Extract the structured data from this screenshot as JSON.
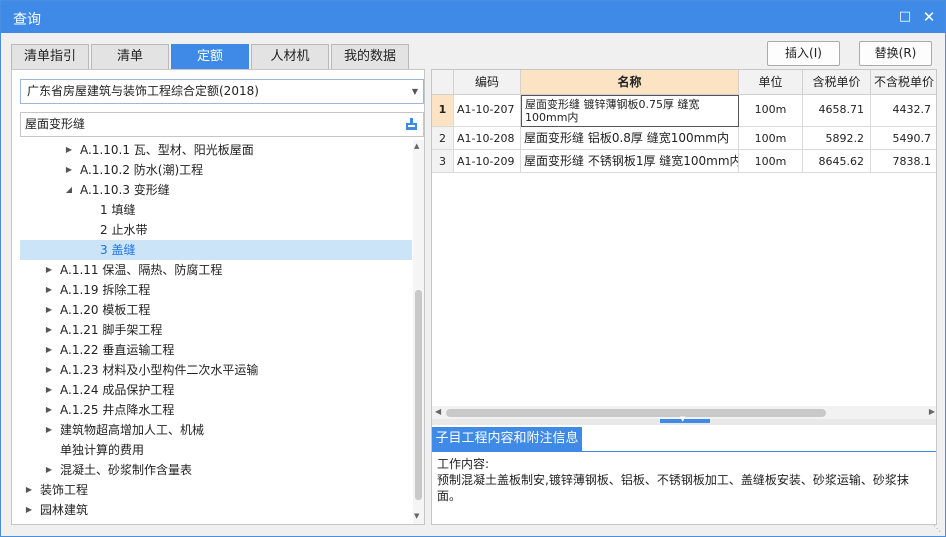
{
  "window": {
    "title": "查询",
    "maximize_icon": "maximize-icon",
    "close_icon": "close-icon"
  },
  "tabs": [
    {
      "label": "清单指引",
      "active": false
    },
    {
      "label": "清单",
      "active": false
    },
    {
      "label": "定额",
      "active": true
    },
    {
      "label": "人材机",
      "active": false
    },
    {
      "label": "我的数据",
      "active": false
    }
  ],
  "actions": {
    "insert": "插入(I)",
    "replace": "替换(R)"
  },
  "library": {
    "selected": "广东省房屋建筑与装饰工程综合定额(2018)"
  },
  "search": {
    "value": "屋面变形缝",
    "icon": "search-icon"
  },
  "tree": [
    {
      "label": "A.1.10.1 瓦、型材、阳光板屋面",
      "level": 2,
      "arrow": "collapsed"
    },
    {
      "label": "A.1.10.2 防水(潮)工程",
      "level": 2,
      "arrow": "collapsed"
    },
    {
      "label": "A.1.10.3 变形缝",
      "level": 2,
      "arrow": "expanded"
    },
    {
      "label": "1 填缝",
      "level": 3,
      "arrow": "none"
    },
    {
      "label": "2 止水带",
      "level": 3,
      "arrow": "none"
    },
    {
      "label": "3 盖缝",
      "level": 3,
      "arrow": "none",
      "selected": true
    },
    {
      "label": "A.1.11 保温、隔热、防腐工程",
      "level": 1,
      "arrow": "collapsed"
    },
    {
      "label": "A.1.19 拆除工程",
      "level": 1,
      "arrow": "collapsed"
    },
    {
      "label": "A.1.20 模板工程",
      "level": 1,
      "arrow": "collapsed"
    },
    {
      "label": "A.1.21 脚手架工程",
      "level": 1,
      "arrow": "collapsed"
    },
    {
      "label": "A.1.22 垂直运输工程",
      "level": 1,
      "arrow": "collapsed"
    },
    {
      "label": "A.1.23 材料及小型构件二次水平运输",
      "level": 1,
      "arrow": "collapsed"
    },
    {
      "label": "A.1.24 成品保护工程",
      "level": 1,
      "arrow": "collapsed"
    },
    {
      "label": "A.1.25 井点降水工程",
      "level": 1,
      "arrow": "collapsed"
    },
    {
      "label": "建筑物超高增加人工、机械",
      "level": 1,
      "arrow": "collapsed"
    },
    {
      "label": "单独计算的费用",
      "level": 1,
      "arrow": "none"
    },
    {
      "label": "混凝土、砂浆制作含量表",
      "level": 1,
      "arrow": "collapsed"
    },
    {
      "label": "装饰工程",
      "level": 0,
      "arrow": "collapsed"
    },
    {
      "label": "园林建筑",
      "level": 0,
      "arrow": "collapsed"
    }
  ],
  "grid": {
    "columns": [
      "编码",
      "名称",
      "单位",
      "含税单价",
      "不含税单价"
    ],
    "rows": [
      {
        "num": "1",
        "code": "A1-10-207",
        "name": "屋面变形缝 镀锌薄钢板0.75厚 缝宽100mm内",
        "unit": "100m",
        "tax_price": "4658.71",
        "notax_price": "4432.7"
      },
      {
        "num": "2",
        "code": "A1-10-208",
        "name": "屋面变形缝 铝板0.8厚 缝宽100mm内",
        "unit": "100m",
        "tax_price": "5892.2",
        "notax_price": "5490.7"
      },
      {
        "num": "3",
        "code": "A1-10-209",
        "name": "屋面变形缝 不锈钢板1厚 缝宽100mm内",
        "unit": "100m",
        "tax_price": "8645.62",
        "notax_price": "7838.1"
      }
    ]
  },
  "info": {
    "tab_label": "子目工程内容和附注信息",
    "heading": "工作内容:",
    "content": "预制混凝土盖板制安,镀锌薄钢板、铝板、不锈钢板加工、盖缝板安装、砂浆运输、砂浆抹面。"
  },
  "colors": {
    "accent": "#3e8ae6",
    "header_highlight": "#fbe3c3",
    "tree_selected": "#cce4f7"
  }
}
